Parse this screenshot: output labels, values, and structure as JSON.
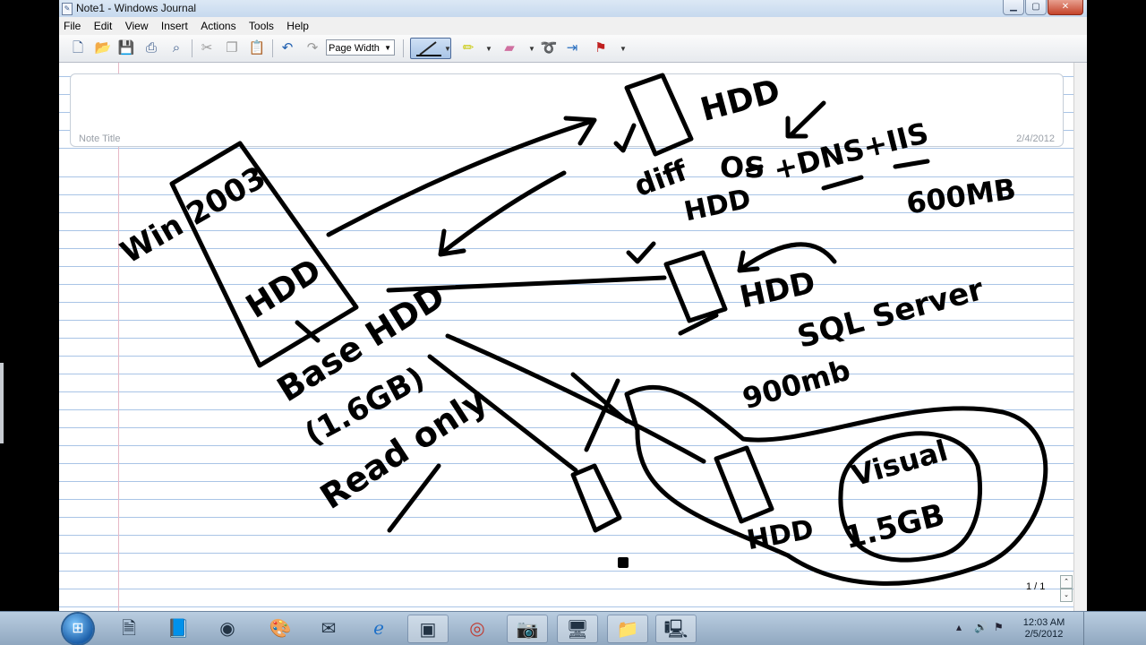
{
  "window": {
    "title": "Note1 - Windows Journal",
    "app_icon": "journal-icon"
  },
  "menu": [
    "File",
    "Edit",
    "View",
    "Insert",
    "Actions",
    "Tools",
    "Help"
  ],
  "toolbar": {
    "zoom_value": "Page Width",
    "icons": [
      "new-note-icon",
      "open-icon",
      "save-icon",
      "print-icon",
      "find-icon",
      "cut-icon",
      "copy-icon",
      "paste-icon",
      "undo-icon",
      "redo-icon",
      "pen-icon",
      "highlighter-icon",
      "eraser-icon",
      "lasso-icon",
      "insert-space-icon",
      "flag-icon"
    ]
  },
  "note": {
    "title_placeholder": "Note Title",
    "date": "2/4/2012",
    "page_indicator": "1 / 1"
  },
  "handwriting": {
    "win_label": "Win 2003",
    "hdd_main": "HDD",
    "base": "Base HDD",
    "size_base": "(1.6GB)",
    "readonly": "Read only",
    "hdd_top": "HDD",
    "diff": "diff",
    "hdd_diff": "HDD",
    "os": "OS",
    "dns_iis": "+DNS+IIS",
    "size_600": "600MB",
    "hdd_sql": "HDD",
    "sql": "SQL Server",
    "size_900": "900mb",
    "hdd_visual": "HDD",
    "visual": "Visual",
    "size_visual": "1.5GB"
  },
  "taskbar": {
    "time": "12:03 AM",
    "date": "2/5/2012",
    "apps": [
      "windows-explorer-icon",
      "notepad-icon",
      "journal-icon",
      "chrome-like-icon",
      "paint-icon",
      "outlook-icon",
      "internet-explorer-icon",
      "virtual-machine-icon",
      "chrome-icon",
      "camera-icon",
      "remote-desktop-icon",
      "folder-icon",
      "vm-console-icon"
    ]
  }
}
